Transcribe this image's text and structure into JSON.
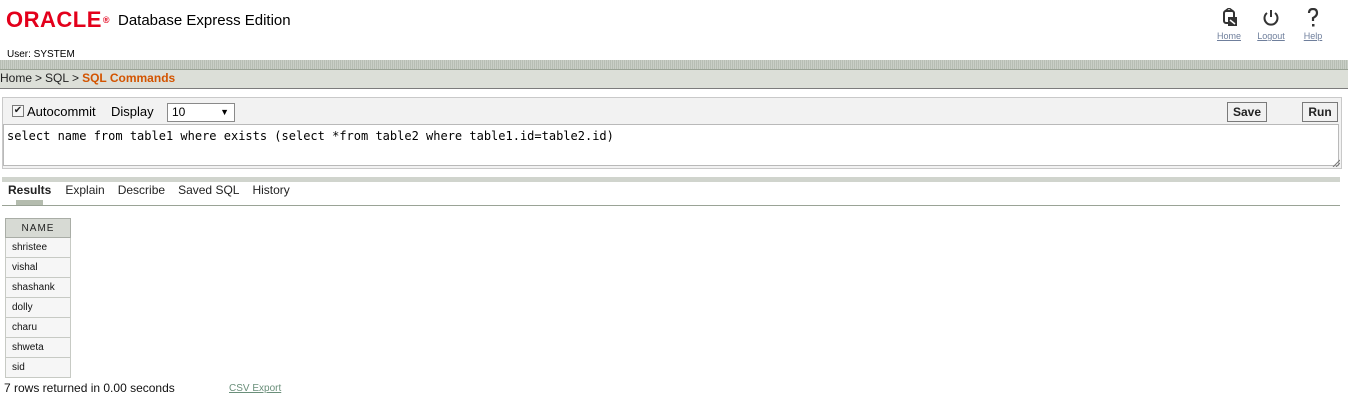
{
  "header": {
    "logo": "ORACLE",
    "logo_mark": "®",
    "product": "Database Express Edition",
    "user": "User: SYSTEM",
    "links": [
      {
        "label": "Home",
        "icon": "home-icon"
      },
      {
        "label": "Logout",
        "icon": "power-icon"
      },
      {
        "label": "Help",
        "icon": "question-icon"
      }
    ]
  },
  "breadcrumb": {
    "home": "Home",
    "sql": "SQL",
    "current": "SQL Commands",
    "sep": ">"
  },
  "editor": {
    "autocommit_label": "Autocommit",
    "autocommit_checked": "✔",
    "display_label": "Display",
    "display_value": "10",
    "save_label": "Save",
    "run_label": "Run",
    "query": "select name from table1 where exists (select *from table2 where table1.id=table2.id)"
  },
  "tabs": [
    "Results",
    "Explain",
    "Describe",
    "Saved SQL",
    "History"
  ],
  "results": {
    "column": "NAME",
    "rows": [
      "shristee",
      "vishal",
      "shashank",
      "dolly",
      "charu",
      "shweta",
      "sid"
    ],
    "status": "7 rows returned in 0.00 seconds",
    "export_label": "CSV Export"
  },
  "colors": {
    "logo_red": "#e3001b",
    "crumb_current": "#d35400"
  }
}
